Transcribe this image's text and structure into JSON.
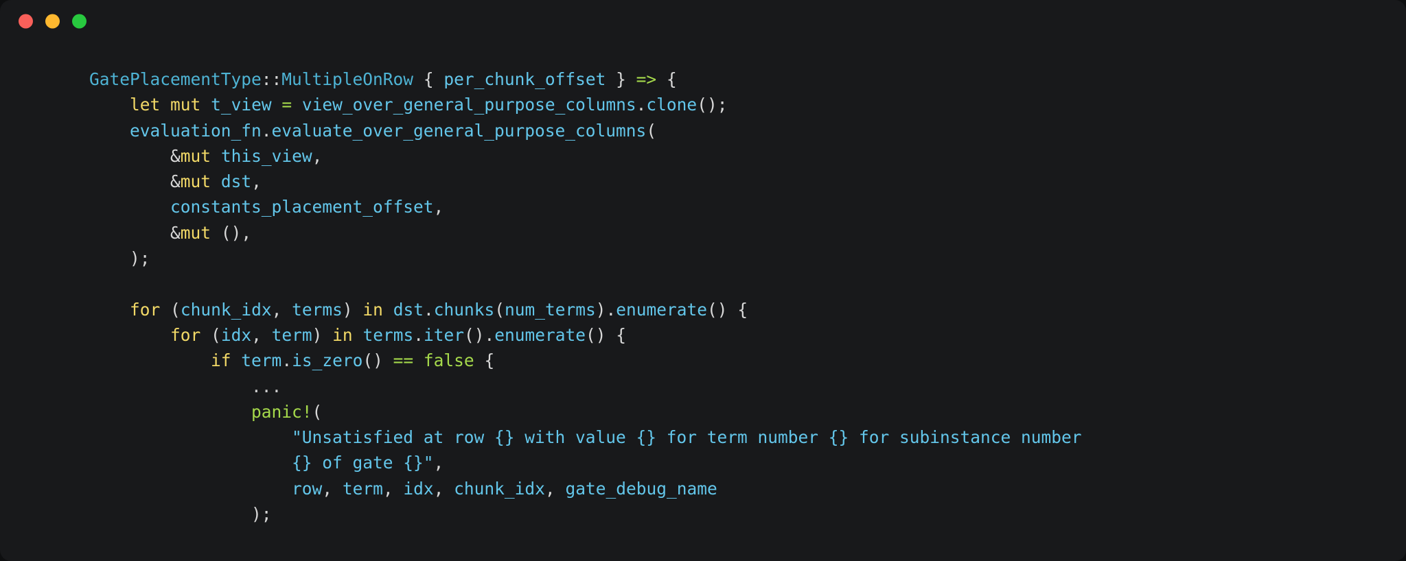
{
  "window": {
    "titlebar": {
      "traffic_lights": [
        {
          "name": "close",
          "color": "#f9605a"
        },
        {
          "name": "minimize",
          "color": "#feb82f"
        },
        {
          "name": "maximize",
          "color": "#28c93f"
        }
      ]
    },
    "background": "#18191b",
    "outer_background": "#0e0f10"
  },
  "code": {
    "language": "rust",
    "font_size_px": 24.5,
    "line_height_px": 37.3,
    "theme": {
      "keyword": "#f2d967",
      "identifier": "#63c6ea",
      "type": "#4eb3d4",
      "operator": "#a5d94b",
      "macro": "#a5d94b",
      "string": "#63c6ea",
      "literal": "#a5d94b",
      "punctuation": "#d8d8d8",
      "plain": "#e6e6e6"
    },
    "lines": [
      {
        "id": "line-1",
        "tokens": [
          {
            "c": "type",
            "t": "GatePlacementType"
          },
          {
            "c": "punc",
            "t": "::"
          },
          {
            "c": "type",
            "t": "MultipleOnRow"
          },
          {
            "c": "plain",
            "t": " "
          },
          {
            "c": "punc",
            "t": "{"
          },
          {
            "c": "plain",
            "t": " "
          },
          {
            "c": "ident",
            "t": "per_chunk_offset"
          },
          {
            "c": "plain",
            "t": " "
          },
          {
            "c": "punc",
            "t": "}"
          },
          {
            "c": "plain",
            "t": " "
          },
          {
            "c": "op",
            "t": "=>"
          },
          {
            "c": "plain",
            "t": " "
          },
          {
            "c": "punc",
            "t": "{"
          }
        ]
      },
      {
        "id": "line-2",
        "tokens": [
          {
            "c": "plain",
            "t": "    "
          },
          {
            "c": "kw",
            "t": "let"
          },
          {
            "c": "plain",
            "t": " "
          },
          {
            "c": "kw",
            "t": "mut"
          },
          {
            "c": "plain",
            "t": " "
          },
          {
            "c": "ident",
            "t": "t_view"
          },
          {
            "c": "plain",
            "t": " "
          },
          {
            "c": "op",
            "t": "="
          },
          {
            "c": "plain",
            "t": " "
          },
          {
            "c": "ident",
            "t": "view_over_general_purpose_columns"
          },
          {
            "c": "punc",
            "t": "."
          },
          {
            "c": "fn",
            "t": "clone"
          },
          {
            "c": "punc",
            "t": "();"
          }
        ]
      },
      {
        "id": "line-3",
        "tokens": [
          {
            "c": "plain",
            "t": "    "
          },
          {
            "c": "ident",
            "t": "evaluation_fn"
          },
          {
            "c": "punc",
            "t": "."
          },
          {
            "c": "fn",
            "t": "evaluate_over_general_purpose_columns"
          },
          {
            "c": "punc",
            "t": "("
          }
        ]
      },
      {
        "id": "line-4",
        "tokens": [
          {
            "c": "plain",
            "t": "        "
          },
          {
            "c": "punc",
            "t": "&"
          },
          {
            "c": "kw",
            "t": "mut"
          },
          {
            "c": "plain",
            "t": " "
          },
          {
            "c": "ident",
            "t": "this_view"
          },
          {
            "c": "punc",
            "t": ","
          }
        ]
      },
      {
        "id": "line-5",
        "tokens": [
          {
            "c": "plain",
            "t": "        "
          },
          {
            "c": "punc",
            "t": "&"
          },
          {
            "c": "kw",
            "t": "mut"
          },
          {
            "c": "plain",
            "t": " "
          },
          {
            "c": "ident",
            "t": "dst"
          },
          {
            "c": "punc",
            "t": ","
          }
        ]
      },
      {
        "id": "line-6",
        "tokens": [
          {
            "c": "plain",
            "t": "        "
          },
          {
            "c": "ident",
            "t": "constants_placement_offset"
          },
          {
            "c": "punc",
            "t": ","
          }
        ]
      },
      {
        "id": "line-7",
        "tokens": [
          {
            "c": "plain",
            "t": "        "
          },
          {
            "c": "punc",
            "t": "&"
          },
          {
            "c": "kw",
            "t": "mut"
          },
          {
            "c": "plain",
            "t": " "
          },
          {
            "c": "punc",
            "t": "(),"
          }
        ]
      },
      {
        "id": "line-8",
        "tokens": [
          {
            "c": "plain",
            "t": "    "
          },
          {
            "c": "punc",
            "t": ");"
          }
        ]
      },
      {
        "id": "line-9",
        "tokens": []
      },
      {
        "id": "line-10",
        "tokens": [
          {
            "c": "plain",
            "t": "    "
          },
          {
            "c": "kw",
            "t": "for"
          },
          {
            "c": "plain",
            "t": " "
          },
          {
            "c": "punc",
            "t": "("
          },
          {
            "c": "ident",
            "t": "chunk_idx"
          },
          {
            "c": "punc",
            "t": ","
          },
          {
            "c": "plain",
            "t": " "
          },
          {
            "c": "ident",
            "t": "terms"
          },
          {
            "c": "punc",
            "t": ")"
          },
          {
            "c": "plain",
            "t": " "
          },
          {
            "c": "kw",
            "t": "in"
          },
          {
            "c": "plain",
            "t": " "
          },
          {
            "c": "ident",
            "t": "dst"
          },
          {
            "c": "punc",
            "t": "."
          },
          {
            "c": "fn",
            "t": "chunks"
          },
          {
            "c": "punc",
            "t": "("
          },
          {
            "c": "ident",
            "t": "num_terms"
          },
          {
            "c": "punc",
            "t": ")."
          },
          {
            "c": "fn",
            "t": "enumerate"
          },
          {
            "c": "punc",
            "t": "()"
          },
          {
            "c": "plain",
            "t": " "
          },
          {
            "c": "punc",
            "t": "{"
          }
        ]
      },
      {
        "id": "line-11",
        "tokens": [
          {
            "c": "plain",
            "t": "        "
          },
          {
            "c": "kw",
            "t": "for"
          },
          {
            "c": "plain",
            "t": " "
          },
          {
            "c": "punc",
            "t": "("
          },
          {
            "c": "ident",
            "t": "idx"
          },
          {
            "c": "punc",
            "t": ","
          },
          {
            "c": "plain",
            "t": " "
          },
          {
            "c": "ident",
            "t": "term"
          },
          {
            "c": "punc",
            "t": ")"
          },
          {
            "c": "plain",
            "t": " "
          },
          {
            "c": "kw",
            "t": "in"
          },
          {
            "c": "plain",
            "t": " "
          },
          {
            "c": "ident",
            "t": "terms"
          },
          {
            "c": "punc",
            "t": "."
          },
          {
            "c": "fn",
            "t": "iter"
          },
          {
            "c": "punc",
            "t": "()."
          },
          {
            "c": "fn",
            "t": "enumerate"
          },
          {
            "c": "punc",
            "t": "()"
          },
          {
            "c": "plain",
            "t": " "
          },
          {
            "c": "punc",
            "t": "{"
          }
        ]
      },
      {
        "id": "line-12",
        "tokens": [
          {
            "c": "plain",
            "t": "            "
          },
          {
            "c": "kw",
            "t": "if"
          },
          {
            "c": "plain",
            "t": " "
          },
          {
            "c": "ident",
            "t": "term"
          },
          {
            "c": "punc",
            "t": "."
          },
          {
            "c": "fn",
            "t": "is_zero"
          },
          {
            "c": "punc",
            "t": "()"
          },
          {
            "c": "plain",
            "t": " "
          },
          {
            "c": "op",
            "t": "=="
          },
          {
            "c": "plain",
            "t": " "
          },
          {
            "c": "lit",
            "t": "false"
          },
          {
            "c": "plain",
            "t": " "
          },
          {
            "c": "punc",
            "t": "{"
          }
        ]
      },
      {
        "id": "line-13",
        "tokens": [
          {
            "c": "plain",
            "t": "                "
          },
          {
            "c": "dim",
            "t": "..."
          }
        ]
      },
      {
        "id": "line-14",
        "tokens": [
          {
            "c": "plain",
            "t": "                "
          },
          {
            "c": "macro",
            "t": "panic!"
          },
          {
            "c": "punc",
            "t": "("
          }
        ]
      },
      {
        "id": "line-15",
        "tokens": [
          {
            "c": "plain",
            "t": "                    "
          },
          {
            "c": "str",
            "t": "\"Unsatisfied at row {} with value {} for term number {} for subinstance number"
          }
        ]
      },
      {
        "id": "line-16",
        "tokens": [
          {
            "c": "plain",
            "t": "                    "
          },
          {
            "c": "str",
            "t": "{} of gate {}\""
          },
          {
            "c": "punc",
            "t": ","
          }
        ]
      },
      {
        "id": "line-17",
        "tokens": [
          {
            "c": "plain",
            "t": "                    "
          },
          {
            "c": "ident",
            "t": "row"
          },
          {
            "c": "punc",
            "t": ","
          },
          {
            "c": "plain",
            "t": " "
          },
          {
            "c": "ident",
            "t": "term"
          },
          {
            "c": "punc",
            "t": ","
          },
          {
            "c": "plain",
            "t": " "
          },
          {
            "c": "ident",
            "t": "idx"
          },
          {
            "c": "punc",
            "t": ","
          },
          {
            "c": "plain",
            "t": " "
          },
          {
            "c": "ident",
            "t": "chunk_idx"
          },
          {
            "c": "punc",
            "t": ","
          },
          {
            "c": "plain",
            "t": " "
          },
          {
            "c": "ident",
            "t": "gate_debug_name"
          }
        ]
      },
      {
        "id": "line-18",
        "tokens": [
          {
            "c": "plain",
            "t": "                "
          },
          {
            "c": "punc",
            "t": ");"
          }
        ]
      }
    ]
  }
}
